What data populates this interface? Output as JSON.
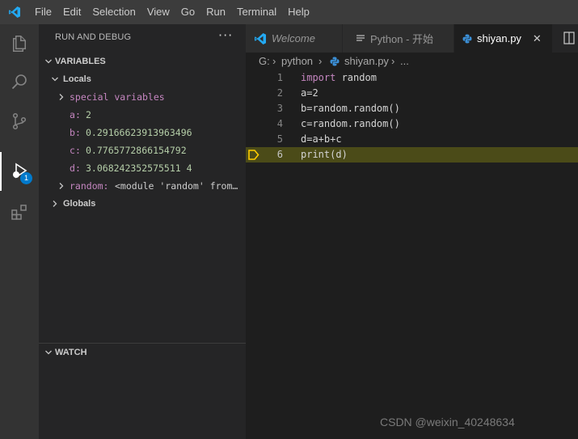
{
  "menu": [
    "File",
    "Edit",
    "Selection",
    "View",
    "Go",
    "Run",
    "Terminal",
    "Help"
  ],
  "activity": {
    "debug_badge": "1"
  },
  "sidebar": {
    "title": "RUN AND DEBUG",
    "more": "···",
    "variables_header": "VARIABLES",
    "locals_label": "Locals",
    "special_variables": "special variables",
    "locals": [
      {
        "name": "a",
        "value": "2"
      },
      {
        "name": "b",
        "value": "0.29166623913963496"
      },
      {
        "name": "c",
        "value": "0.7765772866154792"
      },
      {
        "name": "d",
        "value": "3.068242352575511 4"
      }
    ],
    "random_name": "random",
    "random_value": "<module 'random' from…",
    "globals_label": "Globals",
    "watch_header": "WATCH"
  },
  "tabs": [
    {
      "label": "Welcome",
      "icon": "vscode-logo-icon"
    },
    {
      "label": "Python - 开始",
      "icon": "document-icon"
    },
    {
      "label": "shiyan.py",
      "icon": "python-icon"
    }
  ],
  "tab_close": "✕",
  "breadcrumb": [
    "G:",
    "python",
    "shiyan.py",
    "..."
  ],
  "code": [
    {
      "n": "1",
      "kw": "import",
      "rest": " random"
    },
    {
      "n": "2",
      "kw": "",
      "rest": "a=2"
    },
    {
      "n": "3",
      "kw": "",
      "rest": "b=random.random()"
    },
    {
      "n": "4",
      "kw": "",
      "rest": "c=random.random()"
    },
    {
      "n": "5",
      "kw": "",
      "rest": "d=a+b+c"
    },
    {
      "n": "6",
      "kw": "",
      "rest": "print(d)"
    }
  ],
  "watermark": "CSDN @weixin_40248634",
  "colors": {
    "accent": "#007acc",
    "current_line": "#4b4b18",
    "keyword": "#c586c0",
    "number": "#b5cea8"
  }
}
